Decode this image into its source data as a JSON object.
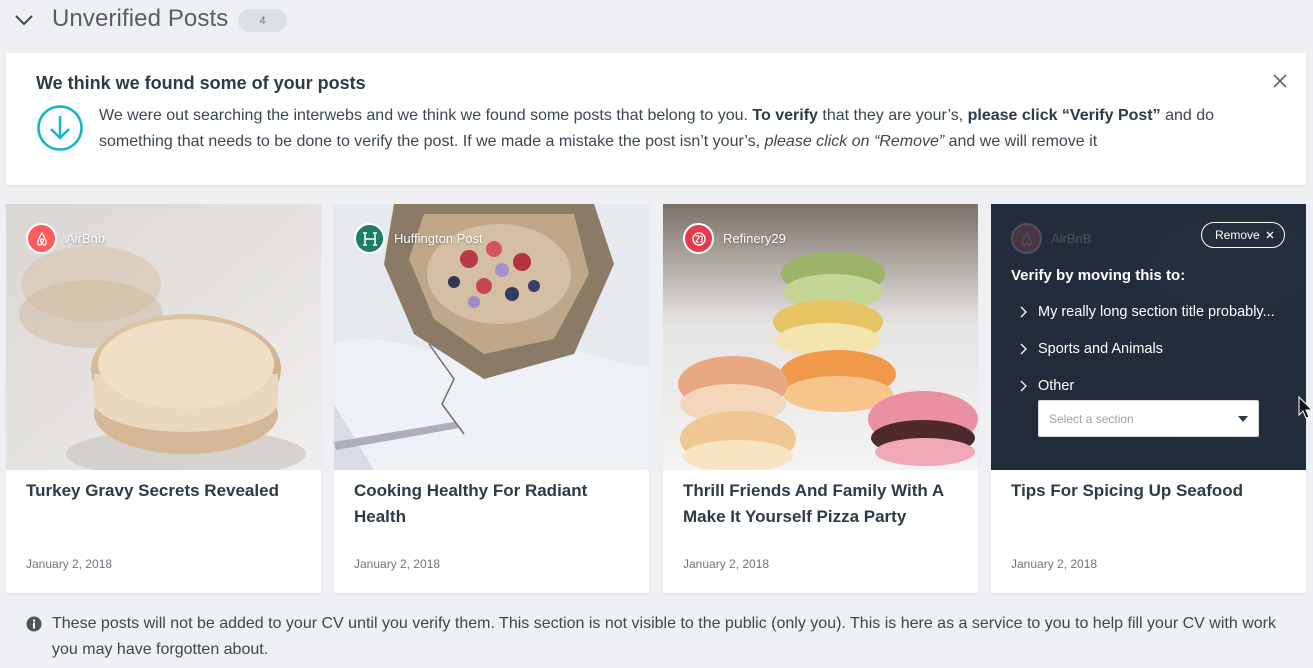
{
  "section": {
    "title": "Unverified Posts",
    "count": "4",
    "collapse_icon": "chevron-down-icon"
  },
  "notice": {
    "title": "We think we found some of your posts",
    "icon": "download-circle-icon",
    "close_icon": "close-icon",
    "text_1": "We were out searching the interwebs and we think we found some posts that belong to you. ",
    "bold_1": "To verify",
    "text_2": " that they are your’s, ",
    "bold_2": "please click “Verify Post”",
    "text_3": " and do something that needs to be done to verify the post. If we made a mistake the post isn’t your’s, ",
    "italic_1": "please click on “Remove”",
    "text_4": " and we will remove it"
  },
  "cards": [
    {
      "source": "AirBnb",
      "source_color": "#ff5a5f",
      "title": "Turkey Gravy Secrets Revealed",
      "date": "January 2, 2018"
    },
    {
      "source": "Huffington Post",
      "source_color": "#1e7e62",
      "title": "Cooking Healthy For Radiant Health",
      "date": "January 2, 2018"
    },
    {
      "source": "Refinery29",
      "source_color": "#e8394c",
      "title": "Thrill Friends And Family With A Make It Yourself Pizza Party",
      "date": "January 2, 2018"
    },
    {
      "source": "AirBnB",
      "source_color": "#ff5a5f",
      "title": "Tips For Spicing Up Seafood",
      "date": "January 2, 2018"
    }
  ],
  "verify_panel": {
    "remove_label": "Remove",
    "heading": "Verify by moving this to:",
    "options": [
      "My really long section title probably...",
      "Sports and Animals",
      "Other"
    ],
    "select_placeholder": "Select a section"
  },
  "footnote": {
    "icon": "info-icon",
    "text": "These posts will not be added to your CV until you verify them. This section is not visible to the public (only you). This is here as a service to you to help fill your CV with work you may have forgotten about."
  }
}
